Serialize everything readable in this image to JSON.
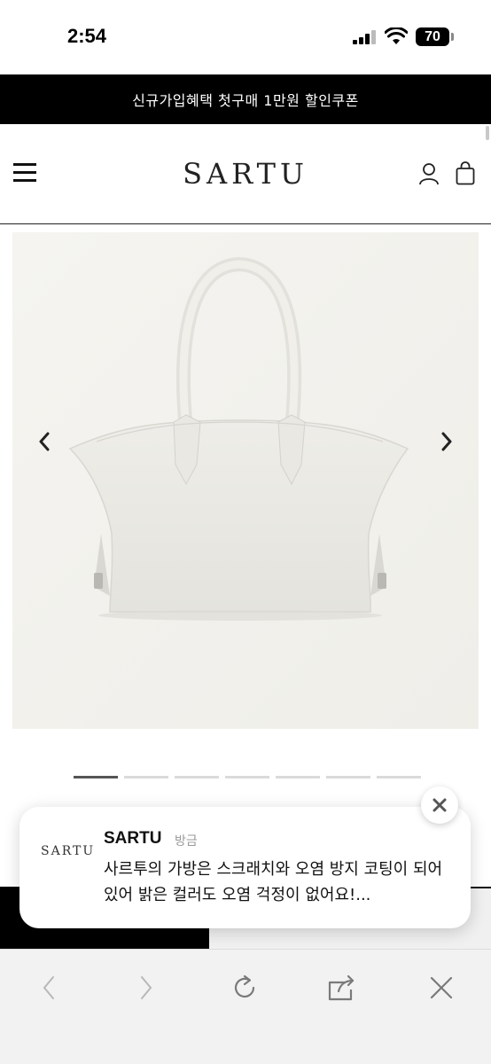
{
  "status_bar": {
    "time": "2:54",
    "battery": "70"
  },
  "promo_banner": {
    "text": "신규가입혜택 첫구매 1만원 할인쿠폰"
  },
  "header": {
    "brand": "SARTU"
  },
  "carousel": {
    "slide_count": 7,
    "active_slide": 1,
    "product_color": "#ecebe6"
  },
  "notification": {
    "logo_text": "SARTU",
    "sender": "SARTU",
    "time": "방금",
    "body": "사르투의 가방은 스크래치와 오염 방지 코팅이 되어 있어 밝은 컬러도 오염 걱정이 없어요!..."
  },
  "browser_toolbar": {
    "icons": [
      "back-arrow-icon",
      "forward-arrow-icon",
      "reload-icon",
      "share-icon",
      "close-icon"
    ]
  }
}
